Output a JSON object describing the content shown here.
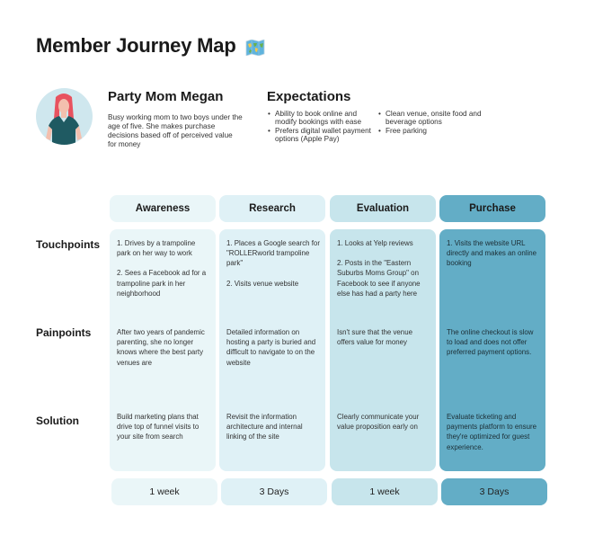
{
  "title": "Member Journey Map",
  "title_icon": "world-map-icon",
  "persona": {
    "name": "Party Mom Megan",
    "description": "Busy working mom to two boys under the age of five. She makes purchase decisions based off of perceived value for money",
    "avatar_icon": "woman-avatar-icon"
  },
  "expectations": {
    "title": "Expectations",
    "column_1": [
      "Ability to book online and modify bookings with ease",
      "Prefers digital wallet payment options (Apple Pay)"
    ],
    "column_2": [
      "Clean venue, onsite food and beverage options",
      "Free parking"
    ]
  },
  "row_labels": {
    "touchpoints": "Touchpoints",
    "painpoints": "Painpoints",
    "solution": "Solution"
  },
  "stages": [
    {
      "name": "Awareness",
      "touchpoints": [
        "1. Drives by a trampoline park on her way to work",
        "2. Sees a Facebook ad for a trampoline park in her neighborhood"
      ],
      "painpoints": "After two years of pandemic parenting, she no longer knows where the best party venues are",
      "solution": "Build marketing plans that drive top of funnel visits to your site from search",
      "duration": "1 week",
      "color": "#eaf6f8"
    },
    {
      "name": "Research",
      "touchpoints": [
        "1. Places a Google search for \"ROLLERworld trampoline park\"",
        "2. Visits venue website"
      ],
      "painpoints": "Detailed information on hosting a party is buried and difficult to navigate to on the website",
      "solution": "Revisit the information architecture and internal linking of the site",
      "duration": "3 Days",
      "color": "#dff1f6"
    },
    {
      "name": "Evaluation",
      "touchpoints": [
        "1. Looks at Yelp reviews",
        "2. Posts in the \"Eastern Suburbs Moms Group\" on Facebook to see if anyone else has had a party here"
      ],
      "painpoints": "Isn't sure that the venue offers value for money",
      "solution": "Clearly communicate your value proposition early on",
      "duration": "1 week",
      "color": "#c7e5ec"
    },
    {
      "name": "Purchase",
      "touchpoints": [
        "1. Visits the website URL directly and makes an online booking"
      ],
      "painpoints": "The online checkout is slow to load and does not offer preferred payment options.",
      "solution": "Evaluate ticketing and payments platform to ensure they're optimized for guest experience.",
      "duration": "3 Days",
      "color": "#63adc6"
    }
  ]
}
